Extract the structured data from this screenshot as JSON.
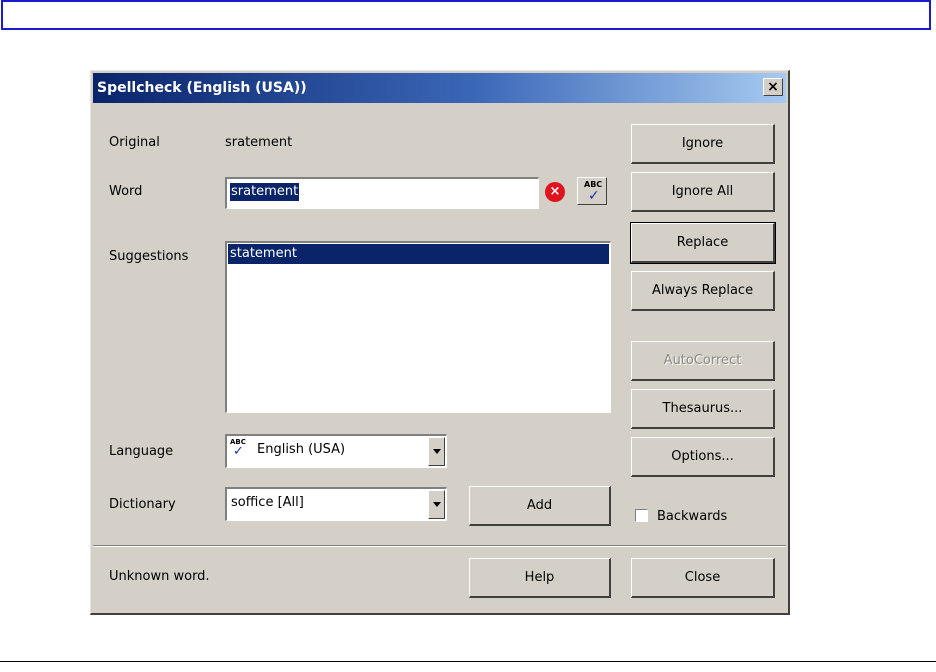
{
  "window": {
    "title": "Spellcheck (English (USA))",
    "close_glyph": "×"
  },
  "labels": {
    "original": "Original",
    "original_value": "sratement",
    "word": "Word",
    "suggestions": "Suggestions",
    "language": "Language",
    "dictionary": "Dictionary"
  },
  "word_input": {
    "value": "sratement"
  },
  "suggestions": [
    "statement"
  ],
  "language_select": {
    "value": "English (USA)",
    "icon": "abc-check-icon"
  },
  "dictionary_select": {
    "value": "soffice [All]"
  },
  "buttons": {
    "ignore": "Ignore",
    "ignore_all": "Ignore All",
    "replace": "Replace",
    "always_replace": "Always Replace",
    "autocorrect": "AutoCorrect",
    "thesaurus": "Thesaurus...",
    "options": "Options...",
    "add": "Add",
    "help": "Help",
    "close": "Close"
  },
  "backwards": {
    "label": "Backwards",
    "checked": false
  },
  "status": "Unknown word.",
  "icons": {
    "error": "×",
    "abc": "ABC",
    "check": "✓"
  },
  "colors": {
    "dialog_bg": "#d4d0c8",
    "title_gradient_start": "#0a246a",
    "title_gradient_end": "#a6caf0",
    "selection": "#0a246a",
    "error_icon": "#e0141e"
  }
}
